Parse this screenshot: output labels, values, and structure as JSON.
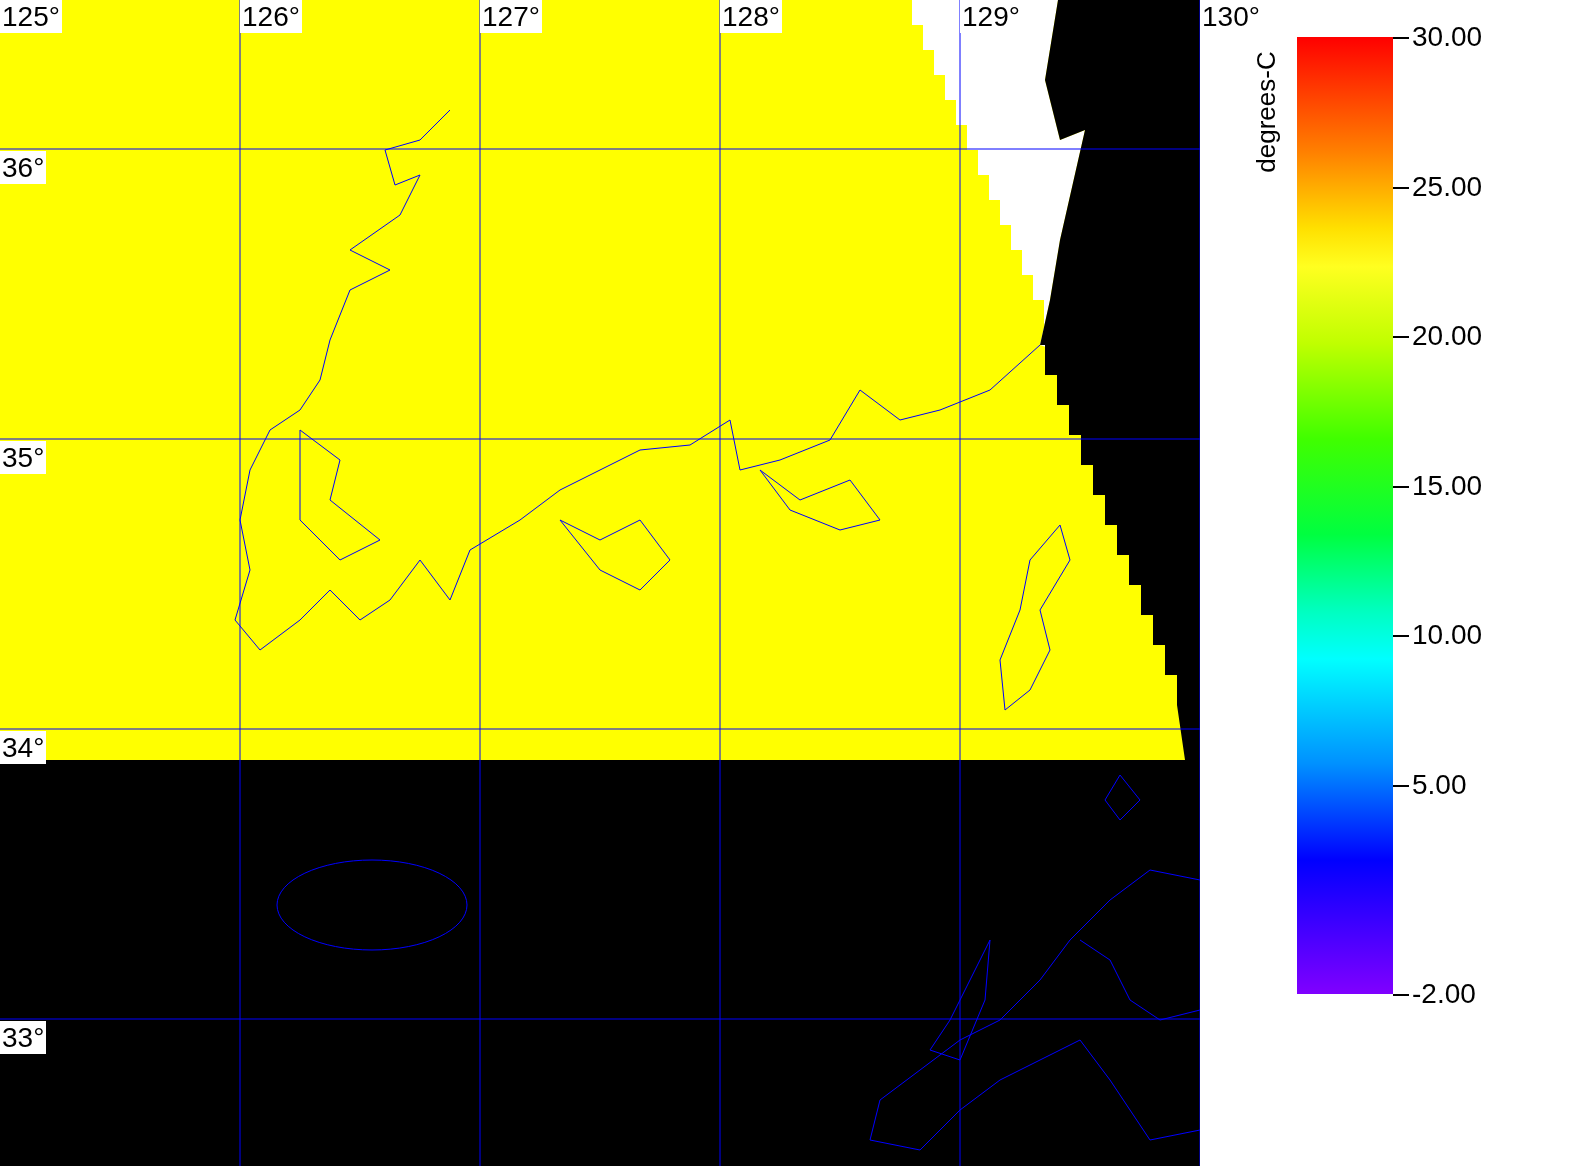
{
  "map": {
    "longitude_labels": [
      "125°",
      "126°",
      "127°",
      "128°",
      "129°",
      "130°"
    ],
    "latitude_labels": [
      "36°",
      "35°",
      "34°",
      "33°"
    ]
  },
  "colorbar": {
    "title": "degrees-C",
    "ticks": [
      "30.00",
      "25.00",
      "20.00",
      "15.00",
      "10.00",
      "5.00",
      "-2.00"
    ]
  }
}
